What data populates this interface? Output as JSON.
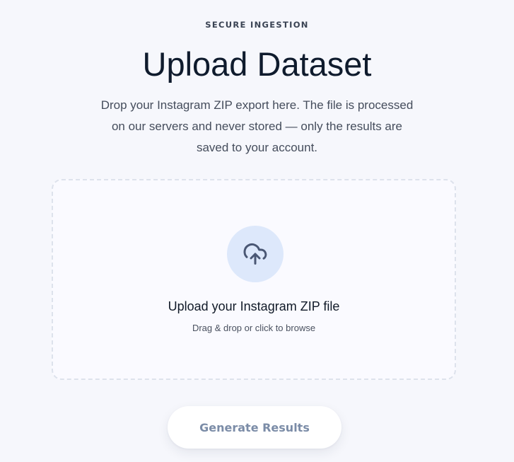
{
  "header": {
    "eyebrow": "SECURE INGESTION",
    "title": "Upload Dataset",
    "subtitle": "Drop your Instagram ZIP export here. The file is processed on our servers and never stored — only the results are saved to your account."
  },
  "dropzone": {
    "icon": "cloud-upload-icon",
    "title": "Upload your Instagram ZIP file",
    "hint": "Drag & drop or click to browse"
  },
  "actions": {
    "generate_label": "Generate Results",
    "generate_enabled": false
  },
  "colors": {
    "background": "#f6f7fc",
    "icon_circle": "#dde8fb",
    "icon_stroke": "#4a5774",
    "button_text_disabled": "#7b8ca7"
  }
}
